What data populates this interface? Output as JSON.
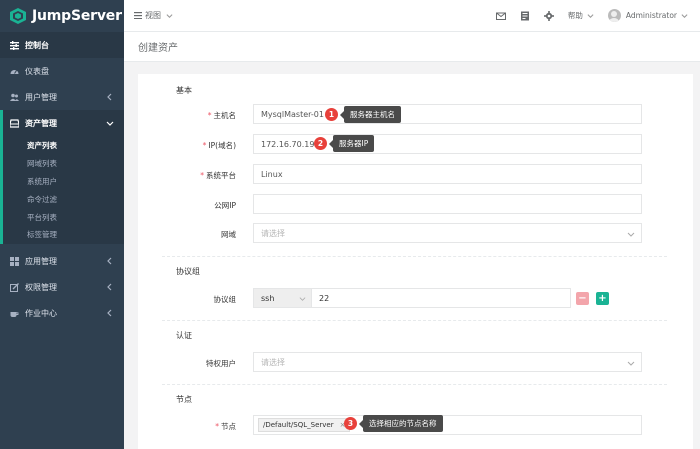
{
  "app": {
    "name": "JumpServer"
  },
  "colors": {
    "sidebar_bg": "#2f4050",
    "accent": "#1ab394",
    "badge": "#e8413b",
    "tooltip_bg": "#4a4a4a"
  },
  "sidebar": {
    "items": [
      {
        "label": "控制台",
        "icon": "dashboard-icon"
      },
      {
        "label": "仪表盘",
        "icon": "gauge-icon"
      },
      {
        "label": "用户管理",
        "icon": "users-icon"
      },
      {
        "label": "资产管理",
        "icon": "inbox-icon"
      },
      {
        "label": "应用管理",
        "icon": "grid-icon"
      },
      {
        "label": "权限管理",
        "icon": "edit-icon"
      },
      {
        "label": "作业中心",
        "icon": "coffee-icon"
      }
    ],
    "asset_sub": [
      "资产列表",
      "网域列表",
      "系统用户",
      "命令过滤",
      "平台列表",
      "标签管理"
    ]
  },
  "topbar": {
    "view_label": "视图",
    "help_label": "帮助",
    "user_name": "Administrator"
  },
  "page": {
    "title": "创建资产"
  },
  "form": {
    "sections": {
      "basic": "基本",
      "protocols": "协议组",
      "auth": "认证",
      "nodes": "节点"
    },
    "hostname": {
      "label": "主机名",
      "value": "MysqlMaster-01",
      "badge": "1",
      "tip": "服务器主机名"
    },
    "ip": {
      "label": "IP(域名)",
      "value": "172.16.70.191",
      "badge": "2",
      "tip": "服务器IP"
    },
    "platform": {
      "label": "系统平台",
      "value": "Linux"
    },
    "public_ip": {
      "label": "公网IP",
      "value": ""
    },
    "domain": {
      "label": "网域",
      "placeholder": "请选择"
    },
    "protocol": {
      "label": "协议组",
      "name": "ssh",
      "port": "22",
      "minus": "−",
      "plus": "+"
    },
    "admin_user": {
      "label": "特权用户",
      "placeholder": "请选择"
    },
    "node": {
      "label": "节点",
      "tag": "/Default/SQL_Server",
      "tag_remove": "×",
      "badge": "3",
      "tip": "选择相应的节点名称"
    }
  }
}
